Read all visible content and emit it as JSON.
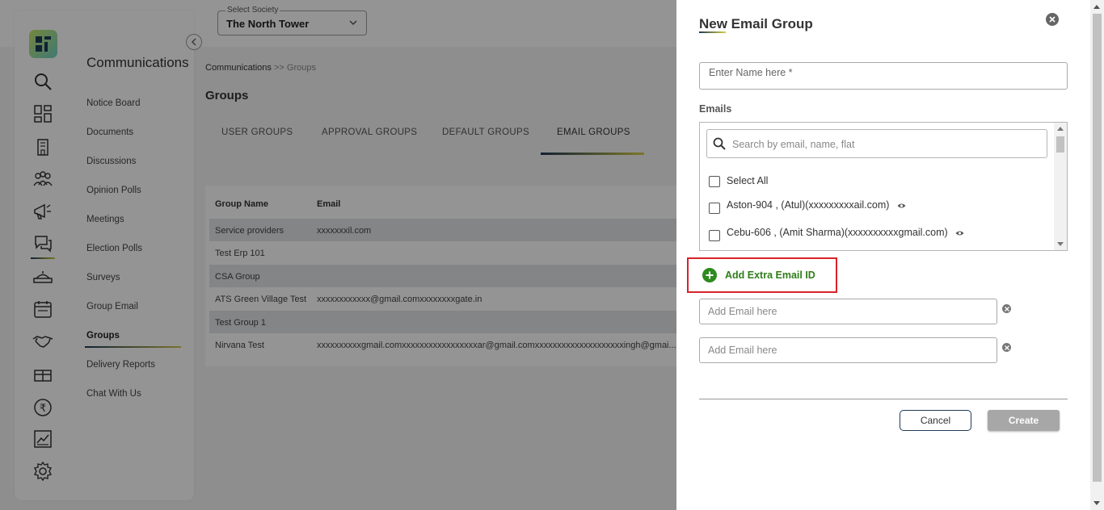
{
  "society_selector": {
    "label": "Select Society",
    "value": "The North Tower"
  },
  "sidebar": {
    "title": "Communications",
    "items": [
      {
        "label": "Notice Board"
      },
      {
        "label": "Documents"
      },
      {
        "label": "Discussions"
      },
      {
        "label": "Opinion Polls"
      },
      {
        "label": "Meetings"
      },
      {
        "label": "Election Polls"
      },
      {
        "label": "Surveys"
      },
      {
        "label": "Group Email"
      },
      {
        "label": "Groups",
        "active": true
      },
      {
        "label": "Delivery Reports"
      },
      {
        "label": "Chat With Us"
      }
    ],
    "rail_icons": [
      "search-icon",
      "dashboard-icon",
      "building-icon",
      "people-icon",
      "megaphone-icon",
      "chat-icon",
      "reception-icon",
      "calendar-icon",
      "handshake-icon",
      "gift-icon",
      "rupee-icon",
      "chart-icon",
      "gear-icon"
    ]
  },
  "breadcrumb": {
    "root": "Communications",
    "rest": " >> Groups"
  },
  "page_title": "Groups",
  "tabs": [
    {
      "label": "USER GROUPS"
    },
    {
      "label": "APPROVAL GROUPS"
    },
    {
      "label": "DEFAULT GROUPS"
    },
    {
      "label": "EMAIL GROUPS",
      "active": true
    }
  ],
  "table": {
    "headers": [
      "Group Name",
      "Email"
    ],
    "rows": [
      [
        "Service providers",
        "xxxxxxxil.com"
      ],
      [
        "Test Erp 101",
        ""
      ],
      [
        "CSA Group",
        ""
      ],
      [
        "ATS Green Village Test",
        "xxxxxxxxxxxx@gmail.comxxxxxxxxgate.in"
      ],
      [
        "Test Group 1",
        ""
      ],
      [
        "Nirvana Test",
        "xxxxxxxxxxgmail.comxxxxxxxxxxxxxxxxxar@gmail.comxxxxxxxxxxxxxxxxxxxxingh@gmai..."
      ]
    ]
  },
  "drawer": {
    "title": "New Email Group",
    "name_placeholder": "Enter Name here *",
    "emails_label": "Emails",
    "search_placeholder": "Search by email, name, flat",
    "select_all": "Select All",
    "members": [
      "Aston-904 , (Atul)(xxxxxxxxxail.com)",
      "Cebu-606 , (Amit Sharma)(xxxxxxxxxxgmail.com)"
    ],
    "add_extra_label": "Add Extra Email ID",
    "extra_email_placeholder": "Add Email here",
    "cancel_label": "Cancel",
    "create_label": "Create",
    "highlight_color": "#d8232a",
    "accent_green": "#2e8b1f"
  }
}
